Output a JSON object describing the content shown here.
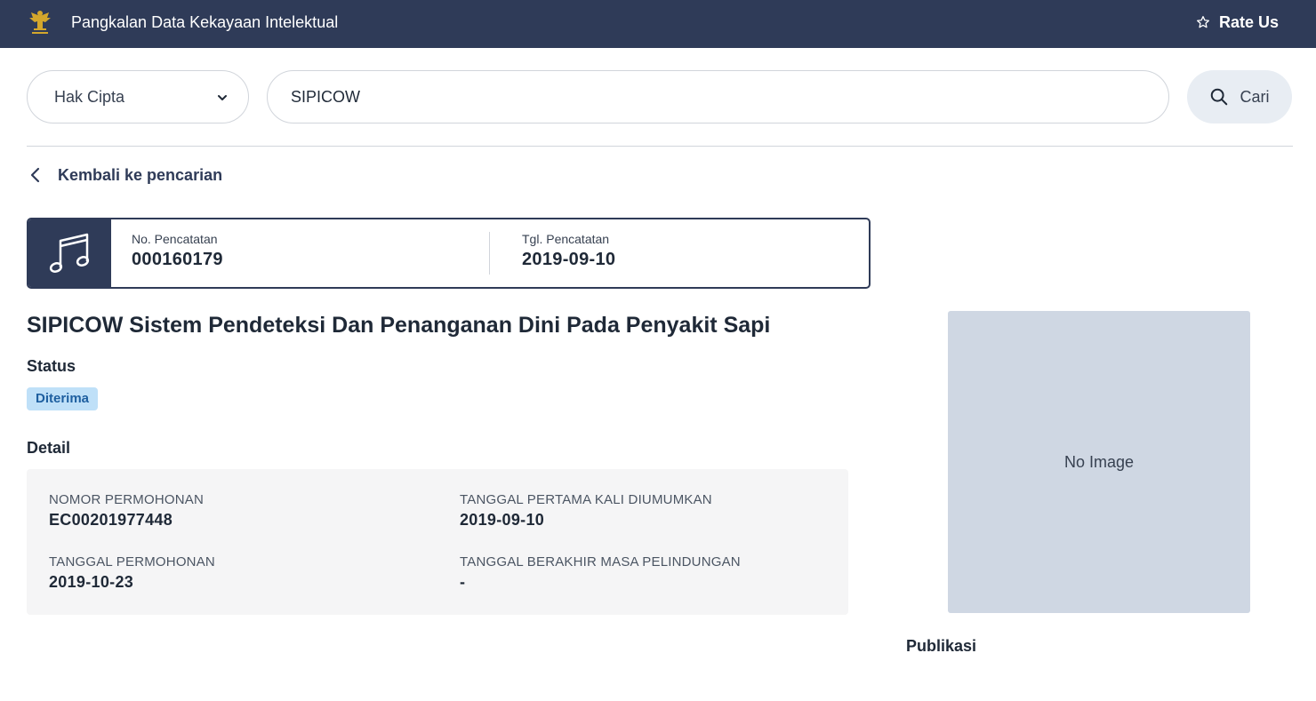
{
  "header": {
    "app_title": "Pangkalan Data Kekayaan Intelektual",
    "rate_us_label": "Rate Us",
    "logo_icon": "garuda-emblem-icon",
    "rate_icon": "star-icon"
  },
  "search": {
    "category_selected": "Hak Cipta",
    "query_value": "SIPICOW",
    "button_label": "Cari"
  },
  "back_link": {
    "label": "Kembali ke pencarian"
  },
  "record": {
    "icon": "music-note-icon",
    "no_label": "No. Pencatatan",
    "no_value": "000160179",
    "date_label": "Tgl. Pencatatan",
    "date_value": "2019-09-10"
  },
  "title": "SIPICOW Sistem Pendeteksi Dan Penanganan Dini Pada Penyakit Sapi",
  "status": {
    "label": "Status",
    "badge": "Diterima"
  },
  "detail": {
    "label": "Detail",
    "fields": [
      {
        "label": "NOMOR PERMOHONAN",
        "value": "EC00201977448"
      },
      {
        "label": "TANGGAL PERTAMA KALI DIUMUMKAN",
        "value": "2019-09-10"
      },
      {
        "label": "TANGGAL PERMOHONAN",
        "value": "2019-10-23"
      },
      {
        "label": "TANGGAL BERAKHIR MASA PELINDUNGAN",
        "value": "-"
      }
    ]
  },
  "image_placeholder": "No Image",
  "publikasi_label": "Publikasi",
  "colors": {
    "navbar": "#2f3b58",
    "badge_bg": "#bfe0f8",
    "badge_text": "#1e5fa0",
    "image_placeholder_bg": "#cfd7e3"
  }
}
